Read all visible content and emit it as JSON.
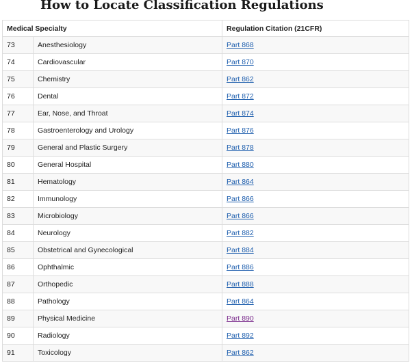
{
  "page": {
    "title": "How to Locate Classification Regulations"
  },
  "table": {
    "headers": {
      "specialty": "Medical Specialty",
      "citation": "Regulation Citation (21CFR)"
    },
    "rows": [
      {
        "code": "73",
        "specialty": "Anesthesiology",
        "citation": "Part 868",
        "visited": false
      },
      {
        "code": "74",
        "specialty": "Cardiovascular",
        "citation": "Part 870",
        "visited": false
      },
      {
        "code": "75",
        "specialty": "Chemistry",
        "citation": "Part 862",
        "visited": false
      },
      {
        "code": "76",
        "specialty": "Dental",
        "citation": "Part 872",
        "visited": false
      },
      {
        "code": "77",
        "specialty": "Ear, Nose, and Throat",
        "citation": "Part 874",
        "visited": false
      },
      {
        "code": "78",
        "specialty": "Gastroenterology and Urology",
        "citation": "Part 876",
        "visited": false
      },
      {
        "code": "79",
        "specialty": "General and Plastic Surgery",
        "citation": "Part 878",
        "visited": false
      },
      {
        "code": "80",
        "specialty": "General Hospital",
        "citation": "Part 880",
        "visited": false
      },
      {
        "code": "81",
        "specialty": "Hematology",
        "citation": "Part 864",
        "visited": false
      },
      {
        "code": "82",
        "specialty": "Immunology",
        "citation": "Part 866",
        "visited": false
      },
      {
        "code": "83",
        "specialty": "Microbiology",
        "citation": "Part 866",
        "visited": false
      },
      {
        "code": "84",
        "specialty": "Neurology",
        "citation": "Part 882",
        "visited": false
      },
      {
        "code": "85",
        "specialty": "Obstetrical and Gynecological",
        "citation": "Part 884",
        "visited": false
      },
      {
        "code": "86",
        "specialty": "Ophthalmic",
        "citation": "Part 886",
        "visited": false
      },
      {
        "code": "87",
        "specialty": "Orthopedic",
        "citation": "Part 888",
        "visited": false
      },
      {
        "code": "88",
        "specialty": "Pathology",
        "citation": "Part 864",
        "visited": false
      },
      {
        "code": "89",
        "specialty": "Physical Medicine",
        "citation": "Part 890",
        "visited": true
      },
      {
        "code": "90",
        "specialty": "Radiology",
        "citation": "Part 892",
        "visited": false
      },
      {
        "code": "91",
        "specialty": "Toxicology",
        "citation": "Part 862",
        "visited": false
      }
    ]
  },
  "colors": {
    "link": "#1f5fae",
    "visited_link": "#7a2b8c",
    "row_alt": "#f8f8f8",
    "border": "#dcdcdc"
  }
}
